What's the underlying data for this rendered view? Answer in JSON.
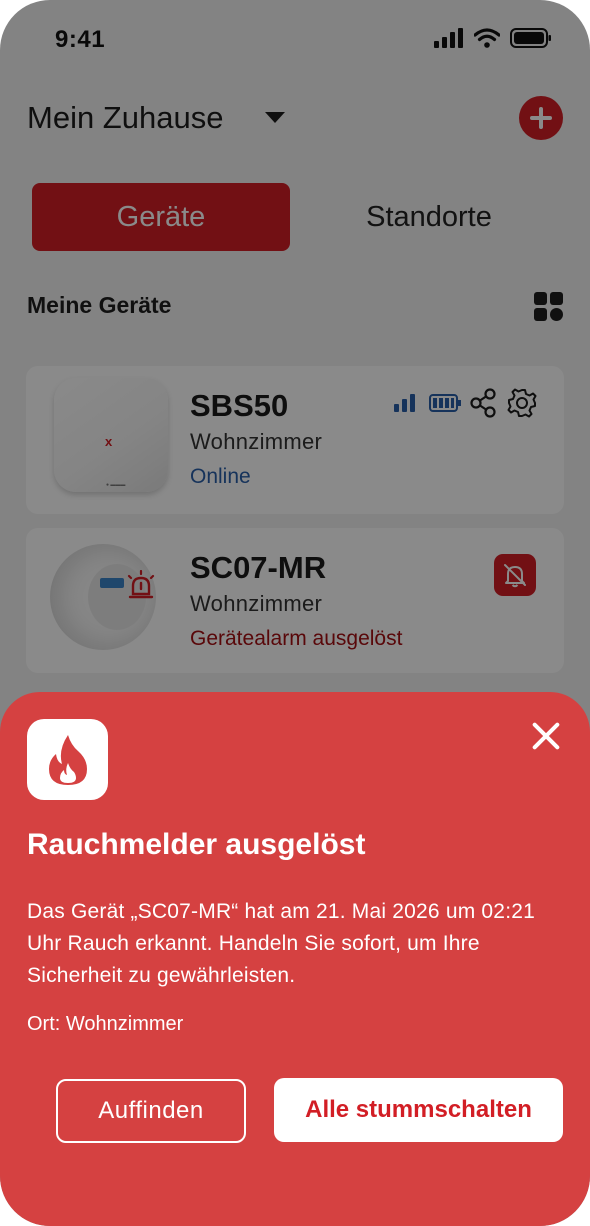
{
  "status_bar": {
    "time": "9:41"
  },
  "header": {
    "home_name": "Mein Zuhause"
  },
  "segment": {
    "devices": "Geräte",
    "locations": "Standorte"
  },
  "section": {
    "title": "Meine Geräte"
  },
  "devices": [
    {
      "name": "SBS50",
      "location": "Wohnzimmer",
      "status": "Online",
      "status_color": "#2a5fa8"
    },
    {
      "name": "SC07-MR",
      "location": "Wohnzimmer",
      "status": "Gerätealarm ausgelöst",
      "status_color": "#a50f14"
    }
  ],
  "alert": {
    "title": "Rauchmelder ausgelöst",
    "message": "Das Gerät „SC07-MR“ hat am 21. Mai 2026 um 02:21 Uhr Rauch erkannt. Handeln Sie sofort, um Ihre Sicherheit zu gewährleisten.",
    "location": "Ort: Wohnzimmer",
    "locate_button": "Auffinden",
    "mute_button": "Alle stummschalten"
  },
  "colors": {
    "brand_red": "#d21e25",
    "sheet_red": "#d54141",
    "link_blue": "#2a5fa8"
  },
  "icons": [
    "signal-icon",
    "wifi-icon",
    "battery-icon",
    "dropdown-caret-icon",
    "add-icon",
    "grid-icon",
    "signal-bars-icon",
    "battery-level-icon",
    "share-icon",
    "gear-icon",
    "alarm-icon",
    "bell-off-icon",
    "flame-icon",
    "close-icon"
  ]
}
